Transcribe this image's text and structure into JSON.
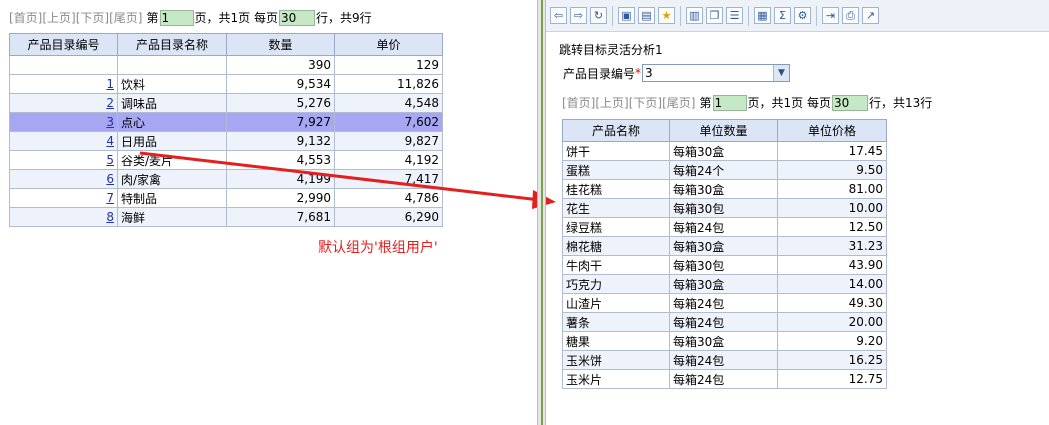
{
  "left_panel": {
    "pager": {
      "first": "[首页]",
      "prev": "[上页]",
      "next": "[下页]",
      "last": "[尾页]",
      "di": "第",
      "page_value": "1",
      "page_suffix": "页，共1页 每页",
      "size_value": "30",
      "size_suffix": "行，共9行"
    },
    "table": {
      "headers": [
        "产品目录编号",
        "产品目录名称",
        "数量",
        "单价"
      ],
      "totals": {
        "qty": "390",
        "price": "129"
      },
      "rows": [
        {
          "id": "1",
          "name": "饮料",
          "qty": "9,534",
          "price": "11,826"
        },
        {
          "id": "2",
          "name": "调味品",
          "qty": "5,276",
          "price": "4,548"
        },
        {
          "id": "3",
          "name": "点心",
          "qty": "7,927",
          "price": "7,602"
        },
        {
          "id": "4",
          "name": "日用品",
          "qty": "9,132",
          "price": "9,827"
        },
        {
          "id": "5",
          "name": "谷类/麦片",
          "qty": "4,553",
          "price": "4,192"
        },
        {
          "id": "6",
          "name": "肉/家禽",
          "qty": "4,199",
          "price": "7,417"
        },
        {
          "id": "7",
          "name": "特制品",
          "qty": "2,990",
          "price": "4,786"
        },
        {
          "id": "8",
          "name": "海鲜",
          "qty": "7,681",
          "price": "6,290"
        }
      ],
      "selected_row": "3"
    }
  },
  "annotation": {
    "text": "默认组为'根组用户'",
    "color": "#e31f1f"
  },
  "right_panel": {
    "toolbar_icons": [
      "arrow-left-icon",
      "arrow-right-icon",
      "refresh-icon",
      "save-icon",
      "save-as-icon",
      "favorite-star-icon",
      "chart-icon",
      "window-icon",
      "filter-list-icon",
      "drill-icon",
      "sum-icon",
      "param-icon",
      "export-icon",
      "print-icon",
      "link-icon"
    ],
    "title": "跳转目标灵活分析1",
    "param": {
      "label": "产品目录编号",
      "required_mark": "*",
      "value": "3"
    },
    "pager": {
      "first": "[首页]",
      "prev": "[上页]",
      "next": "[下页]",
      "last": "[尾页]",
      "di": "第",
      "page_value": "1",
      "page_suffix": "页，共1页 每页",
      "size_value": "30",
      "size_suffix": "行，共13行"
    },
    "table": {
      "headers": [
        "产品名称",
        "单位数量",
        "单位价格"
      ],
      "rows": [
        {
          "name": "饼干",
          "unit": "每箱30盒",
          "price": "17.45"
        },
        {
          "name": "蛋糕",
          "unit": "每箱24个",
          "price": "9.50"
        },
        {
          "name": "桂花糕",
          "unit": "每箱30盒",
          "price": "81.00"
        },
        {
          "name": "花生",
          "unit": "每箱30包",
          "price": "10.00"
        },
        {
          "name": "绿豆糕",
          "unit": "每箱24包",
          "price": "12.50"
        },
        {
          "name": "棉花糖",
          "unit": "每箱30盒",
          "price": "31.23"
        },
        {
          "name": "牛肉干",
          "unit": "每箱30包",
          "price": "43.90"
        },
        {
          "name": "巧克力",
          "unit": "每箱30盒",
          "price": "14.00"
        },
        {
          "name": "山渣片",
          "unit": "每箱24包",
          "price": "49.30"
        },
        {
          "name": "薯条",
          "unit": "每箱24包",
          "price": "20.00"
        },
        {
          "name": "糖果",
          "unit": "每箱30盒",
          "price": "9.20"
        },
        {
          "name": "玉米饼",
          "unit": "每箱24包",
          "price": "16.25"
        },
        {
          "name": "玉米片",
          "unit": "每箱24包",
          "price": "12.75"
        }
      ]
    }
  }
}
